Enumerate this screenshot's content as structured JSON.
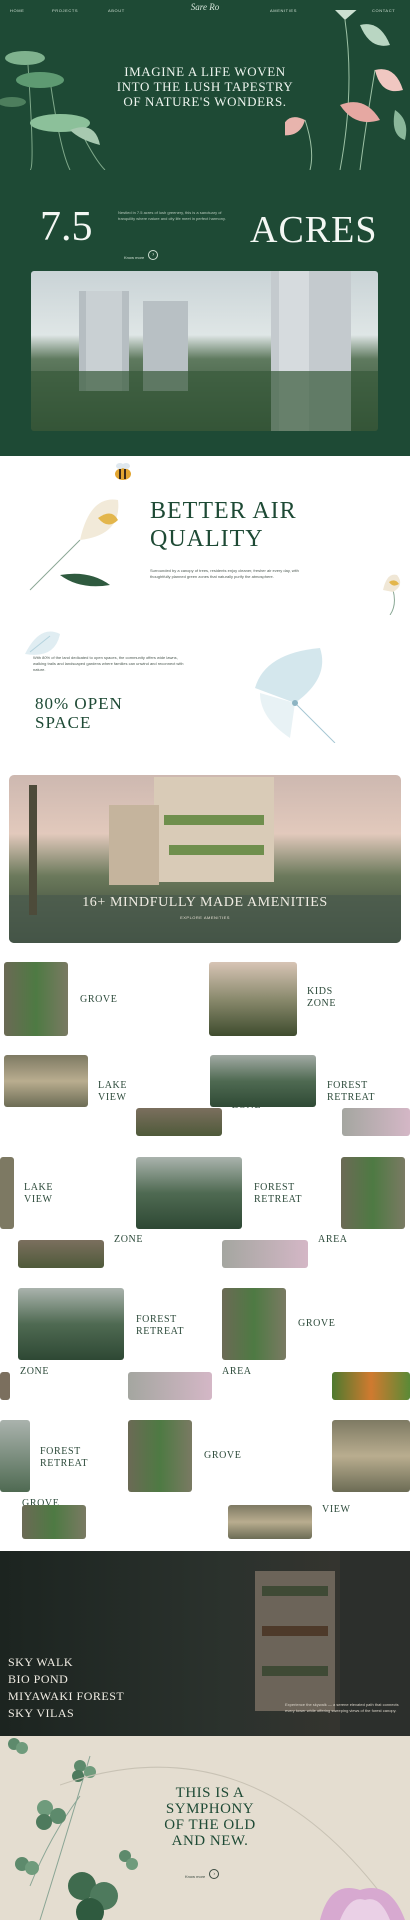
{
  "nav": {
    "items": [
      "HOME",
      "PROJECTS",
      "ABOUT",
      "AMENITIES",
      "CONTACT"
    ],
    "logo": "Sare Ro"
  },
  "hero": {
    "title_lines": [
      "IMAGINE A LIFE WOVEN",
      "INTO THE LUSH TAPESTRY",
      "OF NATURE'S WONDERS."
    ]
  },
  "acres": {
    "number": "7.5",
    "word": "ACRES",
    "blurb": "Nestled in 7.5 acres of lush greenery, this is a sanctuary of tranquility where nature and city life meet in perfect harmony.",
    "link_label": "Know more"
  },
  "air": {
    "title_lines": [
      "BETTER AIR",
      "QUALITY"
    ],
    "text": "Surrounded by a canopy of trees, residents enjoy cleaner, fresher air every day, with thoughtfully planned green zones that naturally purify the atmosphere."
  },
  "open_space": {
    "text": "With 80% of the land dedicated to open spaces, the community offers wide lawns, walking trails and landscaped gardens where families can unwind and reconnect with nature.",
    "title_lines": [
      "80% OPEN",
      "SPACE"
    ]
  },
  "amenities": {
    "title": "16+ MINDFULLY MADE AMENITIES",
    "link_label": "EXPLORE AMENITIES"
  },
  "tiles": {
    "grove": "GROVE",
    "kids": "KIDS ZONE",
    "lake": "LAKE VIEW",
    "forest": "FOREST RETREAT",
    "zone": "ZONE",
    "area": "AREA"
  },
  "features": {
    "items": [
      "SKY WALK",
      "BIO POND",
      "MIYAWAKI FOREST",
      "SKY VILAS"
    ],
    "caption": "Experience the skywalk — a serene elevated path that connects every tower while offering sweeping views of the forest canopy."
  },
  "symphony": {
    "title_lines": [
      "THIS IS A",
      "SYMPHONY",
      "OF THE OLD",
      "AND NEW."
    ],
    "link_label": "Know more"
  },
  "colors": {
    "forest_green": "#1e4a35",
    "beige": "#e4ddd0",
    "accent_pink": "#d7a9d0"
  }
}
